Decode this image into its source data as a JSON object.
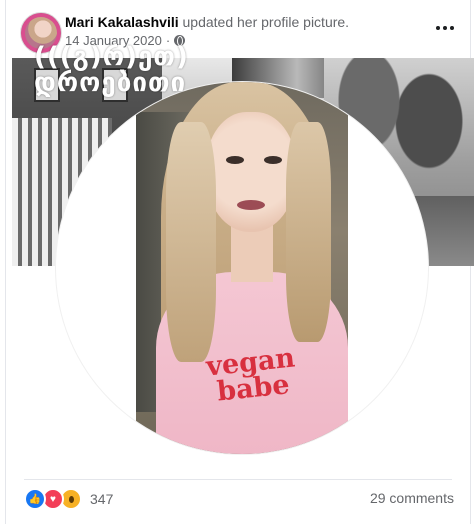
{
  "post": {
    "author": "Mari Kakalashvili",
    "action": "updated her profile picture.",
    "date": "14 January 2020",
    "privacy_icon": "globe-icon",
    "more_icon": "more-options-icon"
  },
  "photo": {
    "overlay_caption": "(((გ)რ)ეთ)\nდროებითი",
    "shirt_text": "vegan babe"
  },
  "footer": {
    "reactions": [
      "like-reaction-icon",
      "love-reaction-icon",
      "wow-reaction-icon"
    ],
    "reaction_count": "347",
    "comments": "29 comments"
  },
  "colors": {
    "like": "#1877f2",
    "love": "#f33e58",
    "wow": "#f7b125",
    "secondary_text": "#65676b"
  }
}
